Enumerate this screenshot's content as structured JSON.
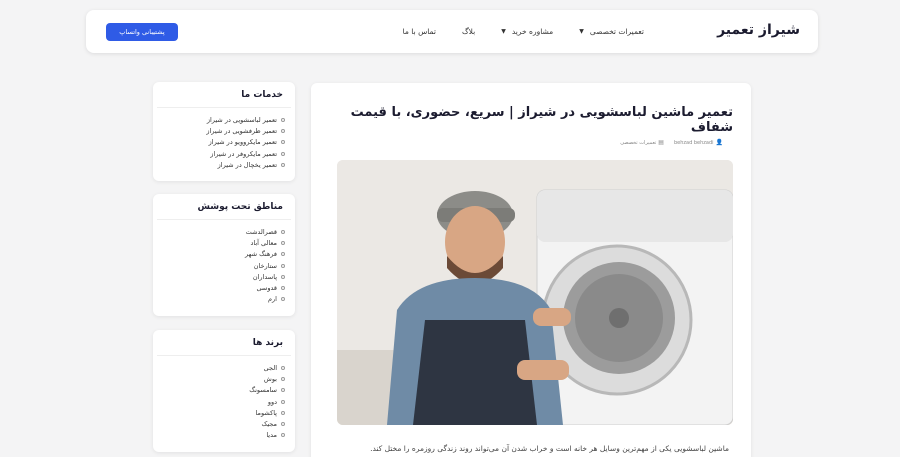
{
  "header": {
    "logo": "شیراز تعمیر",
    "nav": [
      {
        "label": "تعمیرات تخصصی",
        "dropdown": true
      },
      {
        "label": "مشاوره خرید",
        "dropdown": true
      },
      {
        "label": "بلاگ",
        "dropdown": false
      },
      {
        "label": "تماس با ما",
        "dropdown": false
      }
    ],
    "whatsapp_button": "پشتیبانی واتساپ"
  },
  "article": {
    "title": "تعمیر ماشین لباسشویی در شیراز | سریع، حضوری، با قیمت شفاف",
    "author": "behzad behzadi",
    "category": "تعمیرات تخصصی",
    "intro": "ماشین لباسشویی یکی از مهم‌ترین وسایل هر خانه است و خراب شدن آن می‌تواند روند زندگی روزمره را مختل کند."
  },
  "sidebar": {
    "services": {
      "title": "خدمات ما",
      "items": [
        "تعمیر لباسشویی در شیراز",
        "تعمیر ظرفشویی در شیراز",
        "تعمیر مایکروویو در شیراز",
        "تعمیر مایکروفر در شیراز",
        "تعمیر یخچال در شیراز"
      ]
    },
    "areas": {
      "title": "مناطق تحت پوشش",
      "items": [
        "قصرالدشت",
        "معالی آباد",
        "فرهنگ شهر",
        "ستارخان",
        "پاسداران",
        "قدوسی",
        "ارم"
      ]
    },
    "brands": {
      "title": "برند ها",
      "items": [
        "الجی",
        "بوش",
        "سامسونگ",
        "دوو",
        "پاکشوما",
        "مجیک",
        "مدیا"
      ]
    }
  },
  "colors": {
    "accent": "#2f5be6",
    "title": "#1b1b2f",
    "background": "#f4f4f5"
  }
}
